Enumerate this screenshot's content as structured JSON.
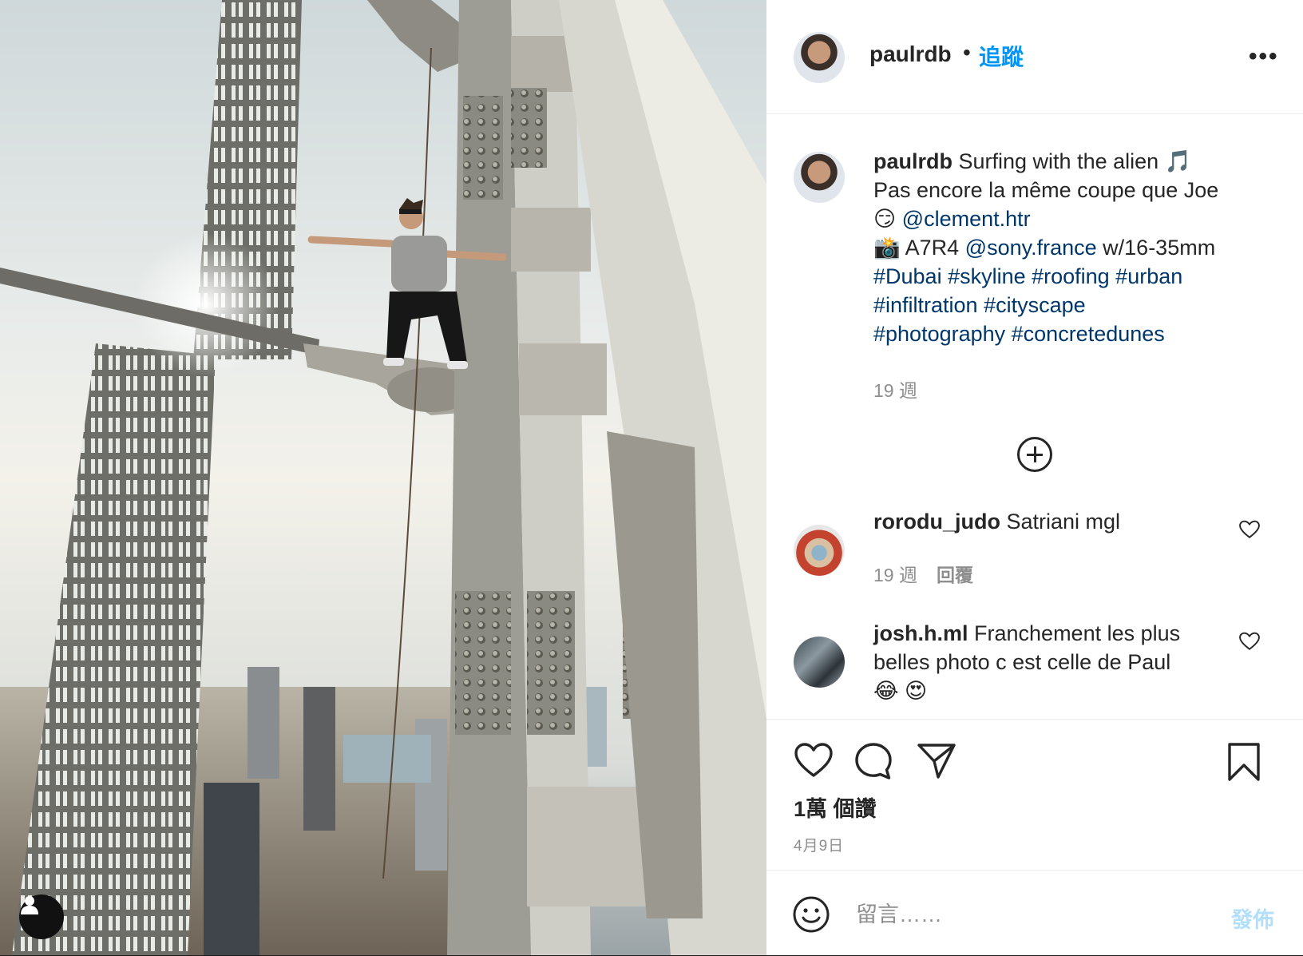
{
  "post": {
    "username": "paulrdb",
    "separator": "•",
    "follow_label": "追蹤",
    "more_icon": "more-horizontal-icon",
    "more_label": "•••"
  },
  "caption": {
    "username": "paulrdb",
    "line1": " Surfing with the alien 🎵",
    "line2": "Pas encore la même coupe que Joe",
    "line3_emoji": "😏 ",
    "line3_mention": "@clement.htr",
    "line4_prefix": "📸 A7R4 ",
    "line4_mention": "@sony.france",
    "line4_suffix": " w/16-35mm",
    "hashtags_line1": "#Dubai #skyline #roofing #urban",
    "hashtags_line2": "#infiltration #cityscape",
    "hashtags_line3": "#photography #concretedunes",
    "time": "19 週"
  },
  "load_more_icon": "plus-circle-icon",
  "comments": [
    {
      "username": "rorodu_judo",
      "text": " Satriani mgl",
      "time": "19 週",
      "reply": "回覆"
    },
    {
      "username": "josh.h.ml",
      "text": " Franchement les plus belles photo c est celle de Paul",
      "emojis": "😂 😍"
    }
  ],
  "actions": {
    "like_icon": "heart-icon",
    "comment_icon": "comment-icon",
    "share_icon": "paper-plane-icon",
    "save_icon": "bookmark-icon"
  },
  "likes": "1萬 個讚",
  "date": "4月9日",
  "compose": {
    "emoji_icon": "smiley-icon",
    "placeholder": "留言……",
    "post_label": "發佈"
  },
  "colors": {
    "link": "#00376b",
    "follow": "#0095f6",
    "post_disabled": "#b2dffc",
    "muted": "#8e8e8e"
  }
}
